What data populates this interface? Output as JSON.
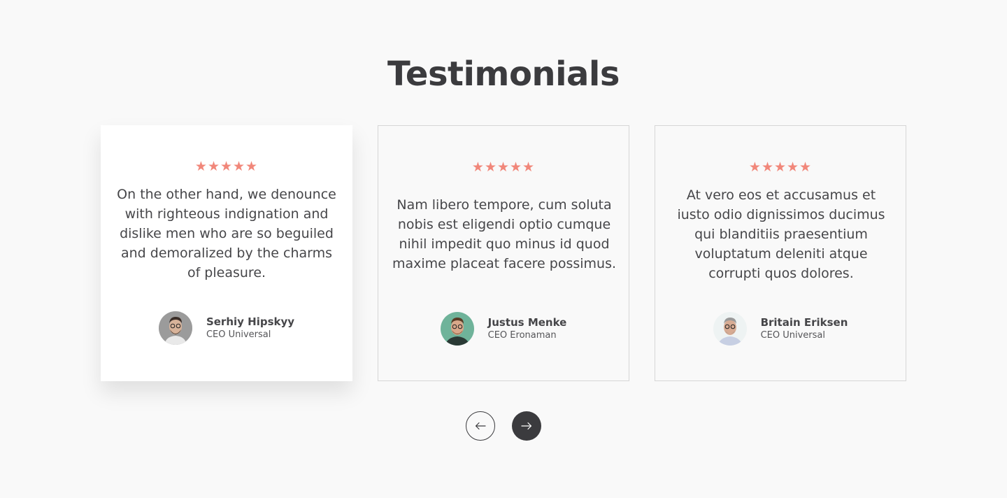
{
  "section": {
    "title": "Testimonials"
  },
  "testimonials": [
    {
      "rating": 5,
      "stars": "★★★★★",
      "quote": "On the other hand, we denounce with righteous indignation and dislike men who are so beguiled and demoralized by the charms of pleasure.",
      "name": "Serhiy Hipskyy",
      "role": "CEO Universal"
    },
    {
      "rating": 5,
      "stars": "★★★★★",
      "quote": "Nam libero tempore, cum soluta nobis est eligendi optio cumque nihil impedit quo minus id quod maxime placeat facere possimus.",
      "name": "Justus Menke",
      "role": "CEO Eronaman"
    },
    {
      "rating": 5,
      "stars": "★★★★★",
      "quote": "At vero eos et accusamus et iusto odio dignissimos ducimus qui blanditiis praesentium voluptatum deleniti atque corrupti quos dolores.",
      "name": "Britain Eriksen",
      "role": "CEO Universal"
    }
  ],
  "navigation": {
    "prev_icon": "arrow-left-icon",
    "next_icon": "arrow-right-icon"
  },
  "colors": {
    "accent_star": "#f1877a",
    "heading": "#3b3b3e",
    "background": "#f9f9f9"
  }
}
